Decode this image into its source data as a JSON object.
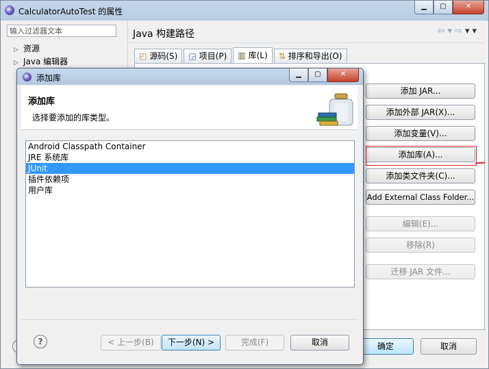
{
  "window": {
    "title": "CalculatorAutoTest 的属性",
    "controls": {
      "minimize": "▁",
      "maximize": "▢",
      "close": "✕"
    }
  },
  "left": {
    "filter_placeholder": "输入过滤器文本",
    "tree": [
      {
        "label": "资源"
      },
      {
        "label": "Java 编辑器"
      }
    ]
  },
  "right": {
    "section_title": "Java 构建路径",
    "nav": {
      "back": "⇦",
      "forward": "⇨",
      "menu": "▾"
    },
    "tabs": [
      {
        "label": "源码(S)",
        "icon": "source-folder-icon"
      },
      {
        "label": "项目(P)",
        "icon": "project-icon"
      },
      {
        "label": "库(L)",
        "icon": "library-icon",
        "selected": true
      },
      {
        "label": "排序和导出(O)",
        "icon": "order-export-icon"
      }
    ],
    "buttons": [
      {
        "label": "添加 JAR...",
        "enabled": true
      },
      {
        "label": "添加外部 JAR(X)...",
        "enabled": true
      },
      {
        "label": "添加变量(V)...",
        "enabled": true
      },
      {
        "label": "添加库(A)...",
        "enabled": true,
        "highlighted": true
      },
      {
        "label": "添加类文件夹(C)...",
        "enabled": true
      },
      {
        "label": "Add External Class Folder...",
        "enabled": true
      },
      {
        "label": "编辑(E)...",
        "enabled": false
      },
      {
        "label": "移除(R)",
        "enabled": false
      },
      {
        "label": "迁移 JAR 文件...",
        "enabled": false
      }
    ],
    "ok": "确定",
    "cancel": "取消"
  },
  "dialog": {
    "title": "添加库",
    "heading": "添加库",
    "subheading": "选择要添加的库类型。",
    "items": [
      {
        "label": "Android Classpath Container"
      },
      {
        "label": "JRE 系统库"
      },
      {
        "label": "JUnit",
        "selected": true
      },
      {
        "label": "插件依赖项"
      },
      {
        "label": "用户库"
      }
    ],
    "help": "?",
    "back": "< 上一步(B)",
    "next": "下一步(N) >",
    "finish": "完成(F)",
    "cancel": "取消"
  },
  "colors": {
    "selection": "#3399ff",
    "highlight_box": "#e02020"
  }
}
